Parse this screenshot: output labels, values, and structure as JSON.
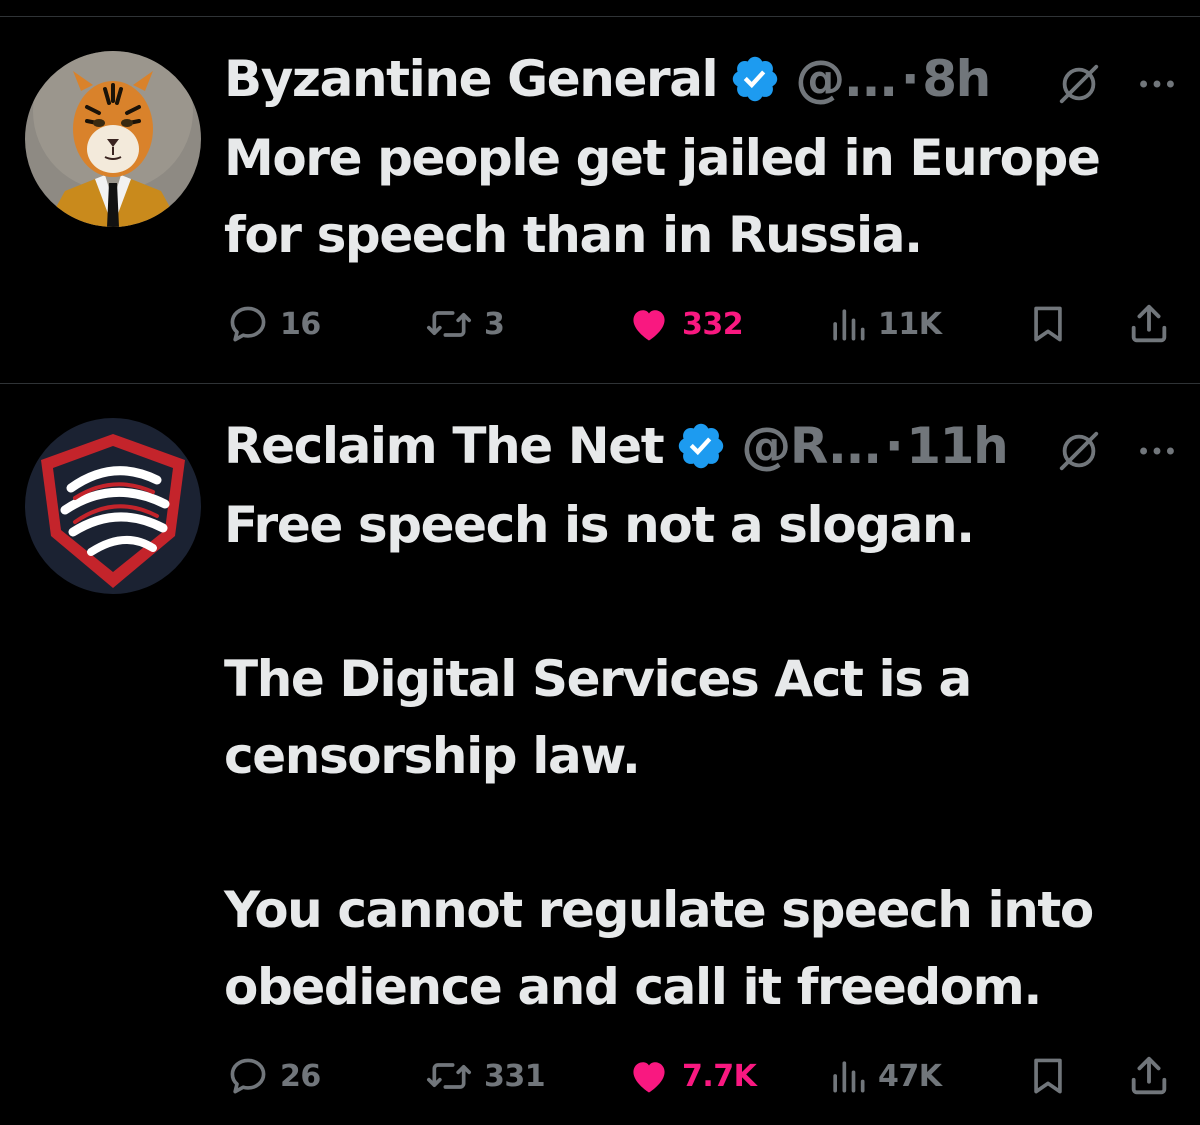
{
  "tweets": [
    {
      "display_name": "Byzantine General",
      "handle": "@...",
      "separator": "·",
      "time": "8h",
      "text": "More people get jailed in Europe\nfor speech than in Russia.",
      "avatar_icon": "tiger-in-suit-avatar",
      "replies": "16",
      "retweets": "3",
      "likes": "332",
      "views": "11K",
      "liked": true
    },
    {
      "display_name": "Reclaim The Net",
      "handle": "@R...",
      "separator": "·",
      "time": "11h",
      "text": "Free speech is not a slogan.\n\nThe Digital Services Act is a\ncensorship law.\n\nYou cannot regulate speech into\nobedience and call it freedom.",
      "avatar_icon": "shield-logo-avatar",
      "replies": "26",
      "retweets": "331",
      "likes": "7.7K",
      "views": "47K",
      "liked": true
    }
  ],
  "colors": {
    "background": "#000000",
    "text_primary": "#e7e9ea",
    "text_secondary": "#71767b",
    "like_pink": "#f91880",
    "verified_blue": "#1d9bf0",
    "divider": "#2f3336"
  },
  "icons": [
    "verified-badge-icon",
    "grok-icon",
    "more-icon",
    "reply-icon",
    "retweet-icon",
    "like-icon",
    "views-icon",
    "bookmark-icon",
    "share-icon"
  ]
}
